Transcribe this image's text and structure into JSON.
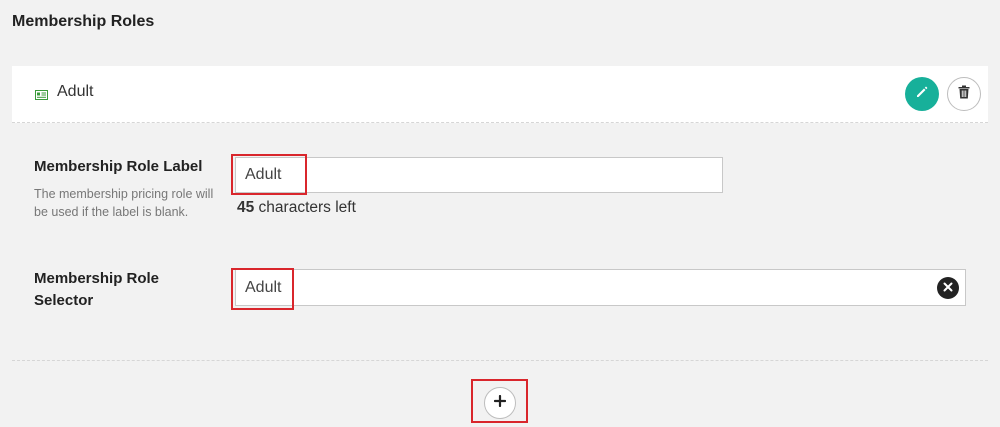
{
  "section": {
    "title": "Membership Roles"
  },
  "role": {
    "name": "Adult",
    "icon": "id-card-icon",
    "actions": {
      "edit_icon": "pencil-icon",
      "delete_icon": "trash-icon"
    }
  },
  "label_field": {
    "label": "Membership Role Label",
    "help": "The membership pricing role will be used if the label is blank.",
    "value": "Adult",
    "chars_left_count": "45",
    "chars_left_text": " characters left"
  },
  "selector_field": {
    "label": "Membership Role Selector",
    "value": "Adult",
    "clear_icon": "clear-x-icon"
  },
  "add_button": {
    "icon": "plus-icon"
  },
  "colors": {
    "accent": "#17b09a",
    "highlight": "#d9262c",
    "icon_green": "#3a9a3a"
  }
}
